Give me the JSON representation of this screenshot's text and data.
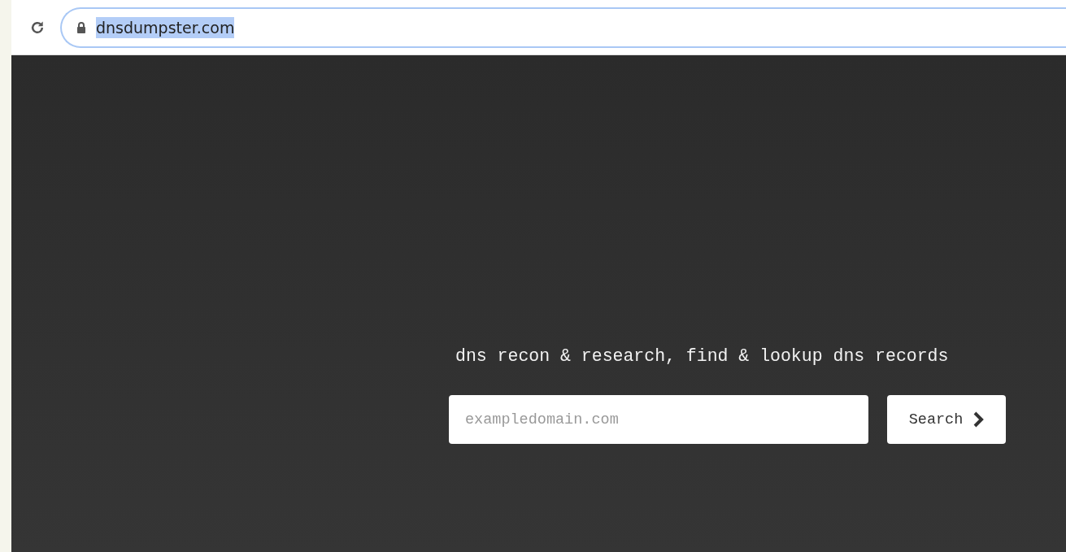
{
  "browser": {
    "url": "dnsdumpster.com",
    "url_selected": true
  },
  "page": {
    "tagline": "dns recon & research, find & lookup dns records",
    "search": {
      "placeholder": "exampledomain.com"
    },
    "search_button": "Search"
  }
}
